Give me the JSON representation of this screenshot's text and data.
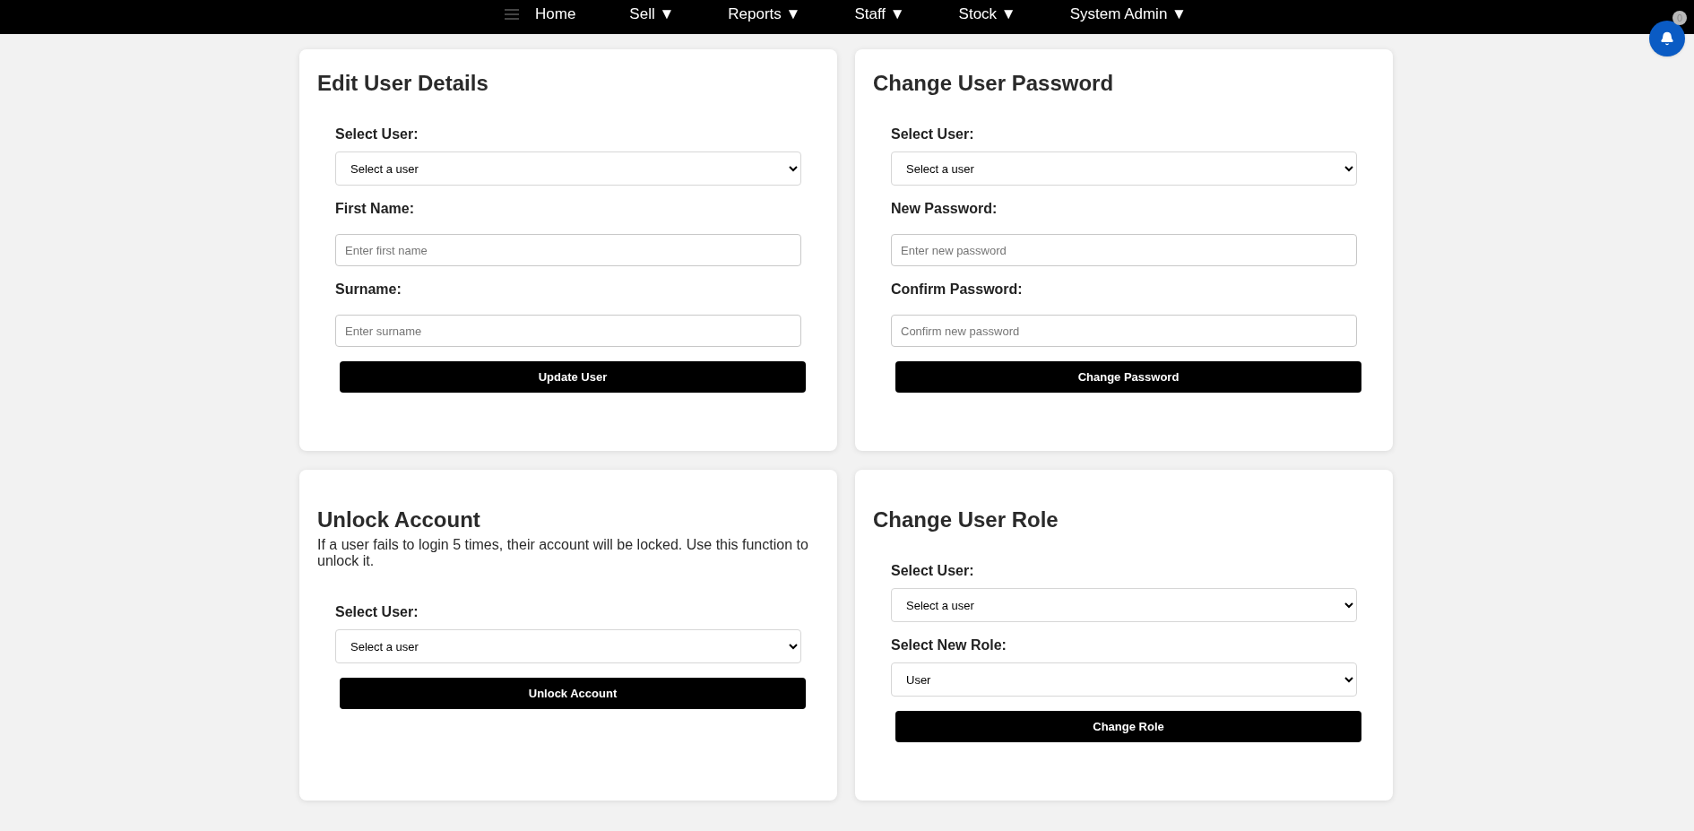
{
  "nav": {
    "items": [
      {
        "label": "Home",
        "has_dropdown": false
      },
      {
        "label": "Sell",
        "has_dropdown": true
      },
      {
        "label": "Reports",
        "has_dropdown": true
      },
      {
        "label": "Staff",
        "has_dropdown": true
      },
      {
        "label": "Stock",
        "has_dropdown": true
      },
      {
        "label": "System Admin",
        "has_dropdown": true
      }
    ],
    "dropdown_mark": "▼"
  },
  "notifications": {
    "count": "0"
  },
  "cards": [
    {
      "title": "Edit User Details",
      "fields": [
        {
          "kind": "select",
          "label": "Select User:",
          "value": "Select a user"
        },
        {
          "kind": "input",
          "label": "First Name:",
          "placeholder": "Enter first name"
        },
        {
          "kind": "input",
          "label": "Surname:",
          "placeholder": "Enter surname"
        }
      ],
      "button": "Update User"
    },
    {
      "title": "Change User Password",
      "fields": [
        {
          "kind": "select",
          "label": "Select User:",
          "value": "Select a user"
        },
        {
          "kind": "input",
          "label": "New Password:",
          "placeholder": "Enter new password"
        },
        {
          "kind": "input",
          "label": "Confirm Password:",
          "placeholder": "Confirm new password"
        }
      ],
      "button": "Change Password"
    },
    {
      "title": "Unlock Account",
      "description": "If a user fails to login 5 times, their account will be locked. Use this function to unlock it.",
      "fields": [
        {
          "kind": "select",
          "label": "Select User:",
          "value": "Select a user"
        }
      ],
      "button": "Unlock Account"
    },
    {
      "title": "Change User Role",
      "fields": [
        {
          "kind": "select",
          "label": "Select User:",
          "value": "Select a user"
        },
        {
          "kind": "select",
          "label": "Select New Role:",
          "value": "User"
        }
      ],
      "button": "Change Role"
    }
  ]
}
